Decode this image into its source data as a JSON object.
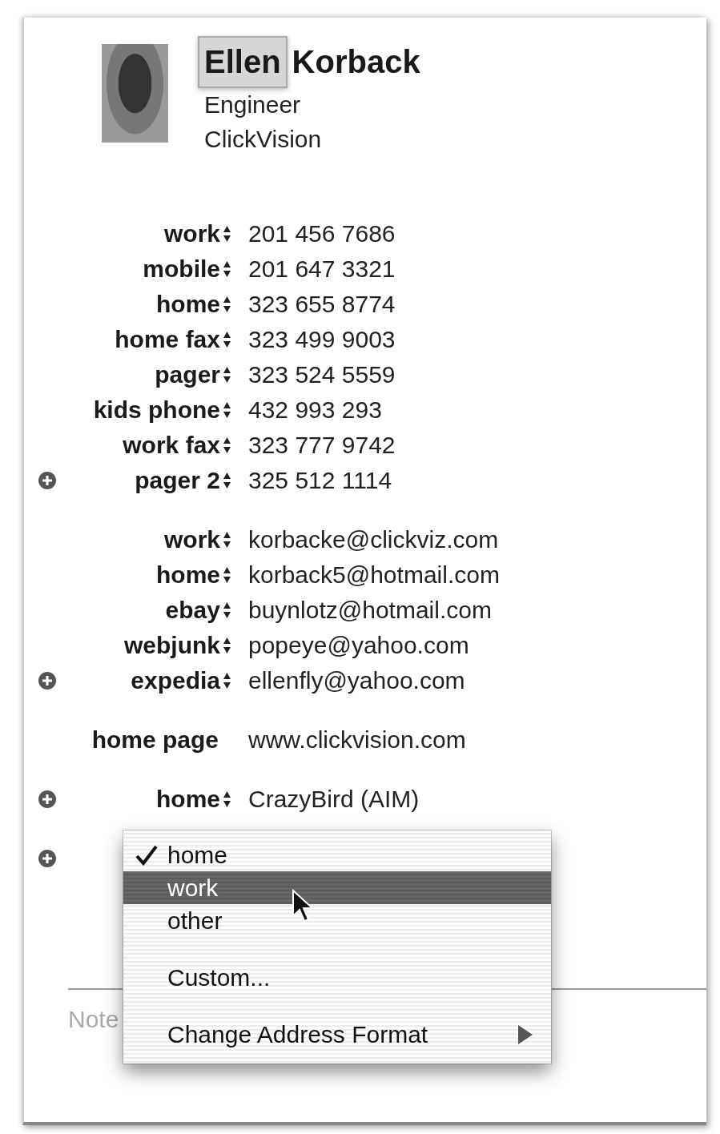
{
  "name": {
    "first": "Ellen",
    "last": "Korback",
    "first_editing": true
  },
  "title": "Engineer",
  "company": "ClickVision",
  "sections": [
    {
      "kind": "popup",
      "rows": [
        {
          "label": "work",
          "value": "201 456 7686",
          "add": false
        },
        {
          "label": "mobile",
          "value": "201 647 3321",
          "add": false
        },
        {
          "label": "home",
          "value": "323 655 8774",
          "add": false
        },
        {
          "label": "home fax",
          "value": "323 499 9003",
          "add": false
        },
        {
          "label": "pager",
          "value": "323 524 5559",
          "add": false
        },
        {
          "label": "kids phone",
          "value": "432 993 293",
          "add": false
        },
        {
          "label": "work fax",
          "value": "323 777 9742",
          "add": false
        },
        {
          "label": "pager 2",
          "value": "325 512 1114",
          "add": true
        }
      ]
    },
    {
      "kind": "popup",
      "rows": [
        {
          "label": "work",
          "value": "korbacke@clickviz.com",
          "add": false
        },
        {
          "label": "home",
          "value": "korback5@hotmail.com",
          "add": false
        },
        {
          "label": "ebay",
          "value": "buynlotz@hotmail.com",
          "add": false
        },
        {
          "label": "webjunk",
          "value": "popeye@yahoo.com",
          "add": false
        },
        {
          "label": "expedia",
          "value": "ellenfly@yahoo.com",
          "add": true
        }
      ]
    },
    {
      "kind": "static",
      "rows": [
        {
          "label": "home page",
          "value": "www.clickvision.com",
          "add": false
        }
      ]
    },
    {
      "kind": "popup",
      "rows": [
        {
          "label": "home",
          "value": "CrazyBird (AIM)",
          "add": true
        }
      ]
    },
    {
      "kind": "hidden",
      "rows": [
        {
          "add": true
        }
      ]
    }
  ],
  "note_label": "Note",
  "menu": {
    "groups": [
      [
        {
          "label": "home",
          "checked": true,
          "selected": false,
          "kind": "item"
        },
        {
          "label": "work",
          "checked": false,
          "selected": true,
          "kind": "item"
        },
        {
          "label": "other",
          "checked": false,
          "selected": false,
          "kind": "item"
        }
      ],
      [
        {
          "label": "Custom...",
          "checked": false,
          "selected": false,
          "kind": "item"
        }
      ],
      [
        {
          "label": "Change Address Format",
          "checked": false,
          "selected": false,
          "kind": "submenu"
        }
      ]
    ]
  }
}
